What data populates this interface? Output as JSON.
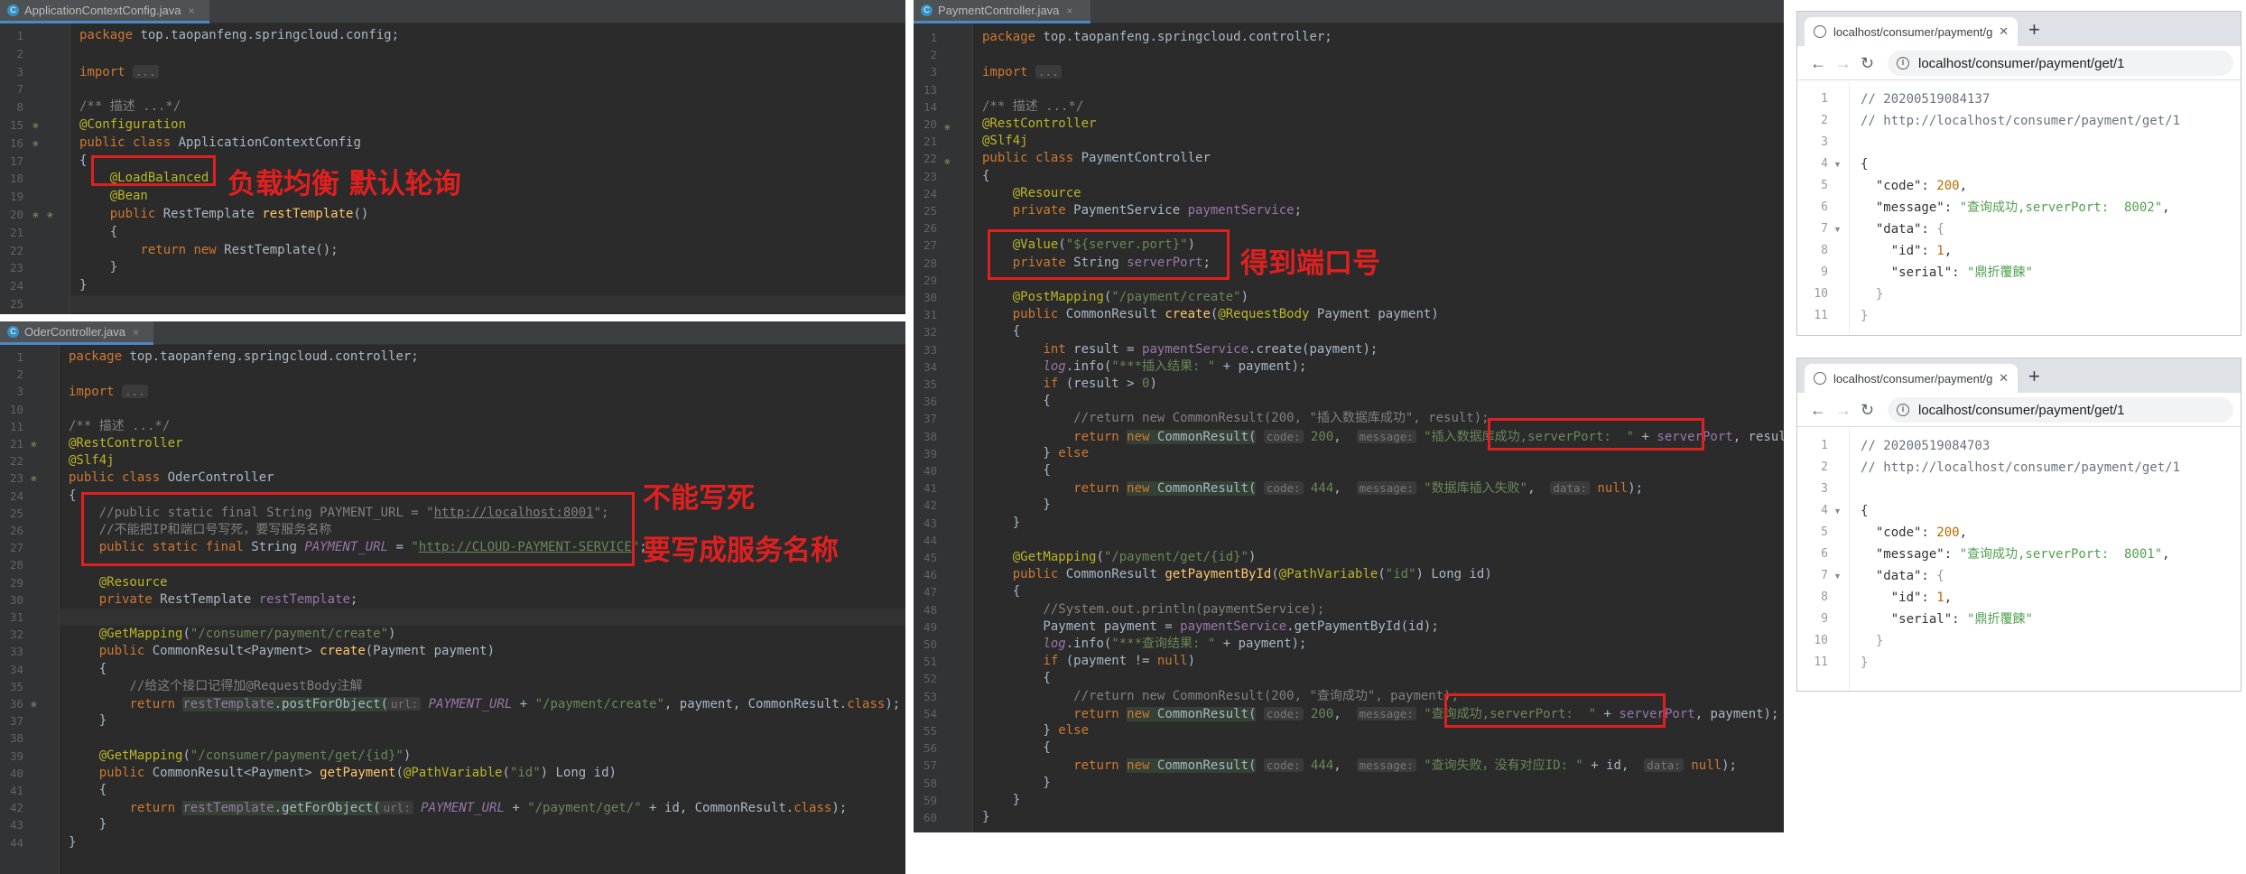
{
  "panel1": {
    "tab": "ApplicationContextConfig.java",
    "annotation": "负载均衡 默认轮询",
    "lines": [
      {
        "n": "1",
        "html": "<span class=\"kw\">package</span> top.taopanfeng.springcloud.config;"
      },
      {
        "n": "2",
        "html": ""
      },
      {
        "n": "3",
        "html": "<span class=\"kw\">import</span> <span class=\"hint\">...</span>"
      },
      {
        "n": "7",
        "html": ""
      },
      {
        "n": "8",
        "html": "<span class=\"cm\">/** 描述 ...*/</span>"
      },
      {
        "n": "15",
        "html": "<span class=\"an\">@Configuration</span>"
      },
      {
        "n": "16",
        "html": "<span class=\"kw\">public class</span> ApplicationContextConfig"
      },
      {
        "n": "17",
        "html": "{"
      },
      {
        "n": "18",
        "html": "    <span class=\"an\">@LoadBalanced</span>"
      },
      {
        "n": "19",
        "html": "    <span class=\"an\">@Bean</span>"
      },
      {
        "n": "20",
        "html": "    <span class=\"kw\">public</span> RestTemplate <span class=\"fn\">restTemplate</span>()"
      },
      {
        "n": "21",
        "html": "    {"
      },
      {
        "n": "22",
        "html": "        <span class=\"kw\">return new</span> RestTemplate();"
      },
      {
        "n": "23",
        "html": "    }"
      },
      {
        "n": "24",
        "html": "}"
      },
      {
        "n": "25",
        "html": ""
      }
    ]
  },
  "panel2": {
    "tab": "OderController.java",
    "annotation1": "不能写死",
    "annotation2": "要写成服务名称",
    "lines": [
      {
        "n": "1",
        "html": "<span class=\"kw\">package</span> top.taopanfeng.springcloud.controller;"
      },
      {
        "n": "2",
        "html": ""
      },
      {
        "n": "3",
        "html": "<span class=\"kw\">import</span> <span class=\"hint\">...</span>"
      },
      {
        "n": "10",
        "html": ""
      },
      {
        "n": "11",
        "html": "<span class=\"cm\">/** 描述 ...*/</span>"
      },
      {
        "n": "21",
        "html": "<span class=\"an\">@RestController</span>"
      },
      {
        "n": "22",
        "html": "<span class=\"an\">@Slf4j</span>"
      },
      {
        "n": "23",
        "html": "<span class=\"kw\">public class</span> OderController"
      },
      {
        "n": "24",
        "html": "{"
      },
      {
        "n": "25",
        "html": "    <span class=\"cm\">//public static final String PAYMENT_URL = \"<u>http://localhost:8001</u>\";</span>"
      },
      {
        "n": "26",
        "html": "    <span class=\"cm\">//不能把IP和端口号写死，要写服务名称</span>"
      },
      {
        "n": "27",
        "html": "    <span class=\"kw\">public static final</span> String <span class=\"fd it\">PAYMENT_URL</span> = <span class=\"st\">\"<u>http://CLOUD-PAYMENT-SERVICE</u>\"</span>;"
      },
      {
        "n": "28",
        "html": ""
      },
      {
        "n": "29",
        "html": "    <span class=\"an\">@Resource</span>"
      },
      {
        "n": "30",
        "html": "    <span class=\"kw\">private</span> RestTemplate <span class=\"fd\">restTemplate</span>;"
      },
      {
        "n": "31",
        "html": ""
      },
      {
        "n": "32",
        "html": "    <span class=\"an\">@GetMapping</span>(<span class=\"st\">\"/consumer/payment/create\"</span>)"
      },
      {
        "n": "33",
        "html": "    <span class=\"kw\">public</span> CommonResult&lt;Payment&gt; <span class=\"fn\">create</span>(Payment payment)"
      },
      {
        "n": "34",
        "html": "    {"
      },
      {
        "n": "35",
        "html": "        <span class=\"cm\">//给这个接口记得加@RequestBody注解</span>"
      },
      {
        "n": "36",
        "html": "        <span class=\"kw\">return</span> <span class=\"dim\"><span class=\"fd\">restTemplate</span>.postForObject(</span><span class=\"hint\">url:</span> <span class=\"fd it\">PAYMENT_URL</span> + <span class=\"st\">\"/payment/create\"</span>, payment, CommonResult.<span class=\"kw\">class</span>);"
      },
      {
        "n": "37",
        "html": "    }"
      },
      {
        "n": "38",
        "html": ""
      },
      {
        "n": "39",
        "html": "    <span class=\"an\">@GetMapping</span>(<span class=\"st\">\"/consumer/payment/get/{id}\"</span>)"
      },
      {
        "n": "40",
        "html": "    <span class=\"kw\">public</span> CommonResult&lt;Payment&gt; <span class=\"fn\">getPayment</span>(<span class=\"an\">@PathVariable</span>(<span class=\"st\">\"id\"</span>) Long id)"
      },
      {
        "n": "41",
        "html": "    {"
      },
      {
        "n": "42",
        "html": "        <span class=\"kw\">return</span> <span class=\"dim\"><span class=\"fd\">restTemplate</span>.getForObject(</span><span class=\"hint\">url:</span> <span class=\"fd it\">PAYMENT_URL</span> + <span class=\"st\">\"/payment/get/\"</span> + id, CommonResult.<span class=\"kw\">class</span>);"
      },
      {
        "n": "43",
        "html": "    }"
      },
      {
        "n": "44",
        "html": "}"
      }
    ]
  },
  "panel3": {
    "tab": "PaymentController.java",
    "annotation": "得到端口号",
    "lines": [
      {
        "n": "1",
        "html": "<span class=\"kw\">package</span> top.taopanfeng.springcloud.controller;"
      },
      {
        "n": "2",
        "html": ""
      },
      {
        "n": "3",
        "html": "<span class=\"kw\">import</span> <span class=\"hint\">...</span>"
      },
      {
        "n": "13",
        "html": ""
      },
      {
        "n": "14",
        "html": "<span class=\"cm\">/** 描述 ...*/</span>"
      },
      {
        "n": "20",
        "html": "<span class=\"an\">@RestController</span>"
      },
      {
        "n": "21",
        "html": "<span class=\"an\">@Slf4j</span>"
      },
      {
        "n": "22",
        "html": "<span class=\"kw\">public class</span> PaymentController"
      },
      {
        "n": "23",
        "html": "{"
      },
      {
        "n": "24",
        "html": "    <span class=\"an\">@Resource</span>"
      },
      {
        "n": "25",
        "html": "    <span class=\"kw\">private</span> PaymentService <span class=\"fd\">paymentService</span>;"
      },
      {
        "n": "26",
        "html": ""
      },
      {
        "n": "27",
        "html": "    <span class=\"an\">@Value</span>(<span class=\"st\">\"${server.port}\"</span>)"
      },
      {
        "n": "28",
        "html": "    <span class=\"kw\">private</span> String <span class=\"fd\">serverPort</span>;"
      },
      {
        "n": "29",
        "html": ""
      },
      {
        "n": "30",
        "html": "    <span class=\"an\">@PostMapping</span>(<span class=\"st\">\"/payment/create\"</span>)"
      },
      {
        "n": "31",
        "html": "    <span class=\"kw\">public</span> CommonResult <span class=\"fn\">create</span>(<span class=\"an\">@RequestBody</span> Payment payment)"
      },
      {
        "n": "32",
        "html": "    {"
      },
      {
        "n": "33",
        "html": "        <span class=\"kw\">int</span> result = <span class=\"fd\">paymentService</span>.create(payment);"
      },
      {
        "n": "34",
        "html": "        <span class=\"fd it\">log</span>.info(<span class=\"st\">\"***插入结果: \"</span> + payment);"
      },
      {
        "n": "35",
        "html": "        <span class=\"kw\">if</span> (result &gt; <span class=\"st\">0</span>)"
      },
      {
        "n": "36",
        "html": "        {"
      },
      {
        "n": "37",
        "html": "            <span class=\"cm\">//return new CommonResult(200, \"插入数据库成功\", result);</span>"
      },
      {
        "n": "38",
        "html": "            <span class=\"kw\">return</span> <span class=\"dim\"><span class=\"kw\">new</span> CommonResult(</span> <span class=\"hint\">code:</span> <span class=\"st\">200</span>,  <span class=\"hint\">message:</span> <span class=\"st\">\"插入数据库成功,serverPort:  \"</span> + <span class=\"fd\">serverPort</span>, result);"
      },
      {
        "n": "39",
        "html": "        } <span class=\"kw\">else</span>"
      },
      {
        "n": "40",
        "html": "        {"
      },
      {
        "n": "41",
        "html": "            <span class=\"kw\">return</span> <span class=\"dim\"><span class=\"kw\">new</span> CommonResult(</span> <span class=\"hint\">code:</span> <span class=\"st\">444</span>,  <span class=\"hint\">message:</span> <span class=\"st\">\"数据库插入失败\"</span>,  <span class=\"hint\">data:</span> <span class=\"kw\">null</span>);"
      },
      {
        "n": "42",
        "html": "        }"
      },
      {
        "n": "43",
        "html": "    }"
      },
      {
        "n": "44",
        "html": ""
      },
      {
        "n": "45",
        "html": "    <span class=\"an\">@GetMapping</span>(<span class=\"st\">\"/payment/get/{id}\"</span>)"
      },
      {
        "n": "46",
        "html": "    <span class=\"kw\">public</span> CommonResult <span class=\"fn\">getPaymentById</span>(<span class=\"an\">@PathVariable</span>(<span class=\"st\">\"id\"</span>) Long id)"
      },
      {
        "n": "47",
        "html": "    {"
      },
      {
        "n": "48",
        "html": "        <span class=\"cm\">//System.out.println(paymentService);</span>"
      },
      {
        "n": "49",
        "html": "        Payment payment = <span class=\"fd\">paymentService</span>.getPaymentById(id);"
      },
      {
        "n": "50",
        "html": "        <span class=\"fd it\">log</span>.info(<span class=\"st\">\"***查询结果: \"</span> + payment);"
      },
      {
        "n": "51",
        "html": "        <span class=\"kw\">if</span> (payment != <span class=\"kw\">null</span>)"
      },
      {
        "n": "52",
        "html": "        {"
      },
      {
        "n": "53",
        "html": "            <span class=\"cm\">//return new CommonResult(200, \"查询成功\", payment);</span>"
      },
      {
        "n": "54",
        "html": "            <span class=\"kw\">return</span> <span class=\"dim\"><span class=\"kw\">new</span> CommonResult(</span> <span class=\"hint\">code:</span> <span class=\"st\">200</span>,  <span class=\"hint\">message:</span> <span class=\"st\">\"查询成功,serverPort:  \"</span> + <span class=\"fd\">serverPort</span>, payment);"
      },
      {
        "n": "55",
        "html": "        } <span class=\"kw\">else</span>"
      },
      {
        "n": "56",
        "html": "        {"
      },
      {
        "n": "57",
        "html": "            <span class=\"kw\">return</span> <span class=\"dim\"><span class=\"kw\">new</span> CommonResult(</span> <span class=\"hint\">code:</span> <span class=\"st\">444</span>,  <span class=\"hint\">message:</span> <span class=\"st\">\"查询失败，没有对应ID: \"</span> + id,  <span class=\"hint\">data:</span> <span class=\"kw\">null</span>);"
      },
      {
        "n": "58",
        "html": "        }"
      },
      {
        "n": "59",
        "html": "    }"
      },
      {
        "n": "60",
        "html": "}"
      }
    ]
  },
  "browser1": {
    "tab_title": "localhost/consumer/payment/get/1",
    "url": "localhost/consumer/payment/get/1",
    "lines": [
      {
        "n": "1",
        "html": "<span class=\"jc\">// 20200519084137</span>"
      },
      {
        "n": "2",
        "html": "<span class=\"jc\">// http://localhost/consumer/payment/get/1</span>"
      },
      {
        "n": "3",
        "html": ""
      },
      {
        "n": "4",
        "fold": true,
        "html": "{"
      },
      {
        "n": "5",
        "html": "  \"code\": <span class=\"jn\">200</span>,"
      },
      {
        "n": "6",
        "html": "  \"message\": <span class=\"js\">\"查询成功,serverPort:  8002\"</span>,"
      },
      {
        "n": "7",
        "fold": true,
        "html": "  \"data\": <span class=\"jb\">{</span>"
      },
      {
        "n": "8",
        "html": "    \"id\": <span class=\"jn\">1</span>,"
      },
      {
        "n": "9",
        "html": "    \"serial\": <span class=\"js\">\"鼎折覆餗\"</span>"
      },
      {
        "n": "10",
        "html": "  <span class=\"jb\">}</span>"
      },
      {
        "n": "11",
        "html": "<span class=\"jb\">}</span>"
      }
    ]
  },
  "browser2": {
    "tab_title": "localhost/consumer/payment/get/1",
    "url": "localhost/consumer/payment/get/1",
    "lines": [
      {
        "n": "1",
        "html": "<span class=\"jc\">// 20200519084703</span>"
      },
      {
        "n": "2",
        "html": "<span class=\"jc\">// http://localhost/consumer/payment/get/1</span>"
      },
      {
        "n": "3",
        "html": ""
      },
      {
        "n": "4",
        "fold": true,
        "html": "{"
      },
      {
        "n": "5",
        "html": "  \"code\": <span class=\"jn\">200</span>,"
      },
      {
        "n": "6",
        "html": "  \"message\": <span class=\"js\">\"查询成功,serverPort:  8001\"</span>,"
      },
      {
        "n": "7",
        "fold": true,
        "html": "  \"data\": <span class=\"jb\">{</span>"
      },
      {
        "n": "8",
        "html": "    \"id\": <span class=\"jn\">1</span>,"
      },
      {
        "n": "9",
        "html": "    \"serial\": <span class=\"js\">\"鼎折覆餗\"</span>"
      },
      {
        "n": "10",
        "html": "  <span class=\"jb\">}</span>"
      },
      {
        "n": "11",
        "html": "<span class=\"jb\">}</span>"
      }
    ]
  },
  "colors": {
    "accent_red": "#e02020",
    "editor_bg": "#2b2b2b",
    "json_string": "#50a14f"
  }
}
